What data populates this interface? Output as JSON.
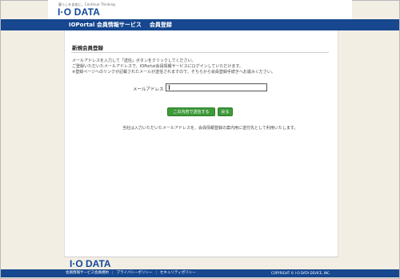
{
  "brand": {
    "tagline": "暮らしを自由に。Continue Thinking",
    "logo": "I·O DATA"
  },
  "header": {
    "service": "IOPortal 会員情報サービス",
    "page": "会員登録"
  },
  "main": {
    "title": "新規会員登録",
    "instructions": [
      "メールアドレスを入力して「送信」ボタンをクリックしてください。",
      "ご登録いただいたメールアドレスで、IOPortal会員情報サービスにログインしていただけます。",
      "※登録ページへのリンクが記載されたメールが送信されますので、そちらから会員登録手続きへお進みください。"
    ],
    "email_label": "メールアドレス",
    "email_value": "",
    "submit_label": "この内容で送信する",
    "back_label": "戻る",
    "note": "当社は入力いただいたメールアドレスを、会員情報登録の案内用に送付先として利用いたします。"
  },
  "footer": {
    "logo": "I·O DATA",
    "links": [
      "会員情報サービス会員規約",
      "プライバシーポリシー",
      "セキュリティポリシー"
    ],
    "copyright": "COPYRIGHT © I-O DATA DEVICE, INC."
  },
  "colors": {
    "brand_blue": "#16478f",
    "button_green": "#3f9a3a",
    "background": "#f3eee4"
  }
}
